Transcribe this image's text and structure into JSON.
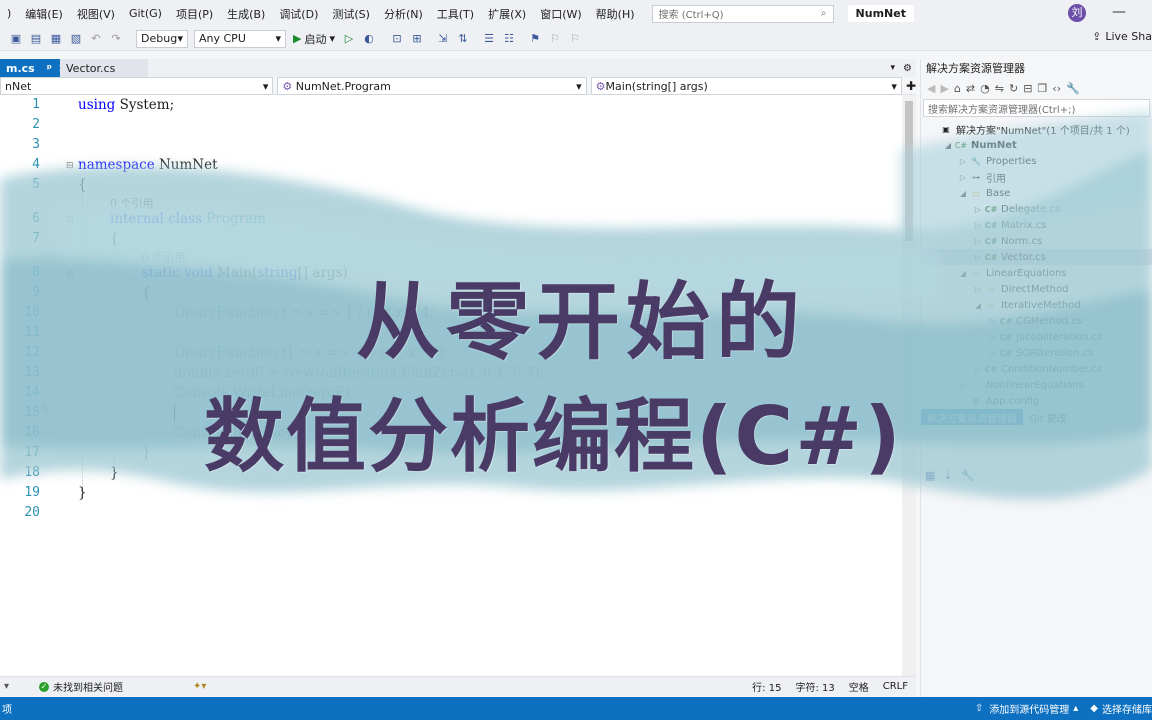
{
  "menu": {
    "items": [
      "编辑(E)",
      "视图(V)",
      "Git(G)",
      "项目(P)",
      "生成(B)",
      "调试(D)",
      "测试(S)",
      "分析(N)",
      "工具(T)",
      "扩展(X)",
      "窗口(W)",
      "帮助(H)"
    ],
    "search_placeholder": "搜索 (Ctrl+Q)",
    "solution_name": "NumNet",
    "avatar_initial": "刘"
  },
  "toolbar": {
    "config": "Debug",
    "platform": "Any CPU",
    "run_label": "启动",
    "liveshare": "Live Sha"
  },
  "tabs": {
    "active": "m.cs",
    "active_pin": "ᵖ",
    "inactive": "Vector.cs"
  },
  "navbar": {
    "project": "nNet",
    "class": "NumNet.Program",
    "member": "Main(string[] args)"
  },
  "editor": {
    "line_numbers": [
      "1",
      "2",
      "3",
      "4",
      "5",
      "6",
      "7",
      "8",
      "9",
      "10",
      "11",
      "12",
      "13",
      "14",
      "15",
      "16",
      "17",
      "18",
      "19",
      "20"
    ],
    "refs_0": "0 个引用",
    "refs_1": "0 个引用",
    "code": {
      "l1_kw": "using",
      "l1_rest": " System;",
      "l4_kw": "namespace",
      "l4_rest": " NumNet",
      "l5": "{",
      "l6_kw": "internal class",
      "l6_ty": " Program",
      "l7": "{",
      "l8_kw": "static void",
      "l8_rest": " Main(",
      "l8_kw2": "string",
      "l8_rest2": "[] args)",
      "l9": "{",
      "l10": "UnaryFunction f = x => 1 / (x * x) - 4;",
      "l12": "UnaryFunction f1 = x => -2 / (x * x * x);",
      "l13": "double zeroF = NewtonIteration.FindZero(f, 0.1, 0.7);",
      "l14": "Console.WriteLine(zeroF);",
      "l16": "Console.ReadKey();",
      "l17": "}",
      "l18": "}",
      "l19": "}"
    }
  },
  "editor_status": {
    "issues": "未找到相关问题",
    "line": "行: 15",
    "char": "字符: 13",
    "space": "空格",
    "eol": "CRLF"
  },
  "solution_explorer": {
    "title": "解决方案资源管理器",
    "search_placeholder": "搜索解决方案资源管理器(Ctrl+;)",
    "items": [
      {
        "label": "解决方案\"NumNet\"(1 个项目/共 1 个)",
        "indent": 0,
        "arrow": "",
        "icon": "solution"
      },
      {
        "label": "NumNet",
        "indent": 1,
        "arrow": "◢",
        "icon": "project",
        "bold": true
      },
      {
        "label": "Properties",
        "indent": 2,
        "arrow": "▷",
        "icon": "wrench"
      },
      {
        "label": "引用",
        "indent": 2,
        "arrow": "▷",
        "icon": "ref"
      },
      {
        "label": "Base",
        "indent": 2,
        "arrow": "◢",
        "icon": "folder"
      },
      {
        "label": "Delegate.cs",
        "indent": 3,
        "arrow": "▷",
        "icon": "cs"
      },
      {
        "label": "Matrix.cs",
        "indent": 3,
        "arrow": "▷",
        "icon": "cs"
      },
      {
        "label": "Norm.cs",
        "indent": 3,
        "arrow": "▷",
        "icon": "cs"
      },
      {
        "label": "Vector.cs",
        "indent": 3,
        "arrow": "▷",
        "icon": "cs",
        "selected": true
      },
      {
        "label": "LinearEquations",
        "indent": 2,
        "arrow": "◢",
        "icon": "folder"
      },
      {
        "label": "DirectMethod",
        "indent": 3,
        "arrow": "▷",
        "icon": "folder"
      },
      {
        "label": "IterativeMethod",
        "indent": 3,
        "arrow": "◢",
        "icon": "folder"
      },
      {
        "label": "CGMethod.cs",
        "indent": 4,
        "arrow": "▷",
        "icon": "cs"
      },
      {
        "label": "JacobiIteration.cs",
        "indent": 4,
        "arrow": "▷",
        "icon": "cs"
      },
      {
        "label": "SORIteration.cs",
        "indent": 4,
        "arrow": "▷",
        "icon": "cs"
      },
      {
        "label": "ConditionNumber.cs",
        "indent": 3,
        "arrow": "▷",
        "icon": "cs"
      },
      {
        "label": "NonlinearEquations",
        "indent": 2,
        "arrow": "▷",
        "icon": "folder"
      },
      {
        "label": "App.config",
        "indent": 2,
        "arrow": "",
        "icon": "config"
      }
    ],
    "tab_active": "解决方案资源管理器",
    "tab_git": "Git 更改"
  },
  "status_bar": {
    "left": "项",
    "add_source": "添加到源代码管理",
    "select_repo": "选择存储库"
  },
  "overlay": {
    "line1": "从零开始的",
    "line2": "数值分析编程(C#)"
  },
  "colors": {
    "accent": "#0e70c0",
    "keyword": "#0000ff",
    "type": "#2b91af",
    "title_text": "#4a3b66",
    "wash": "#9fc9d4"
  }
}
